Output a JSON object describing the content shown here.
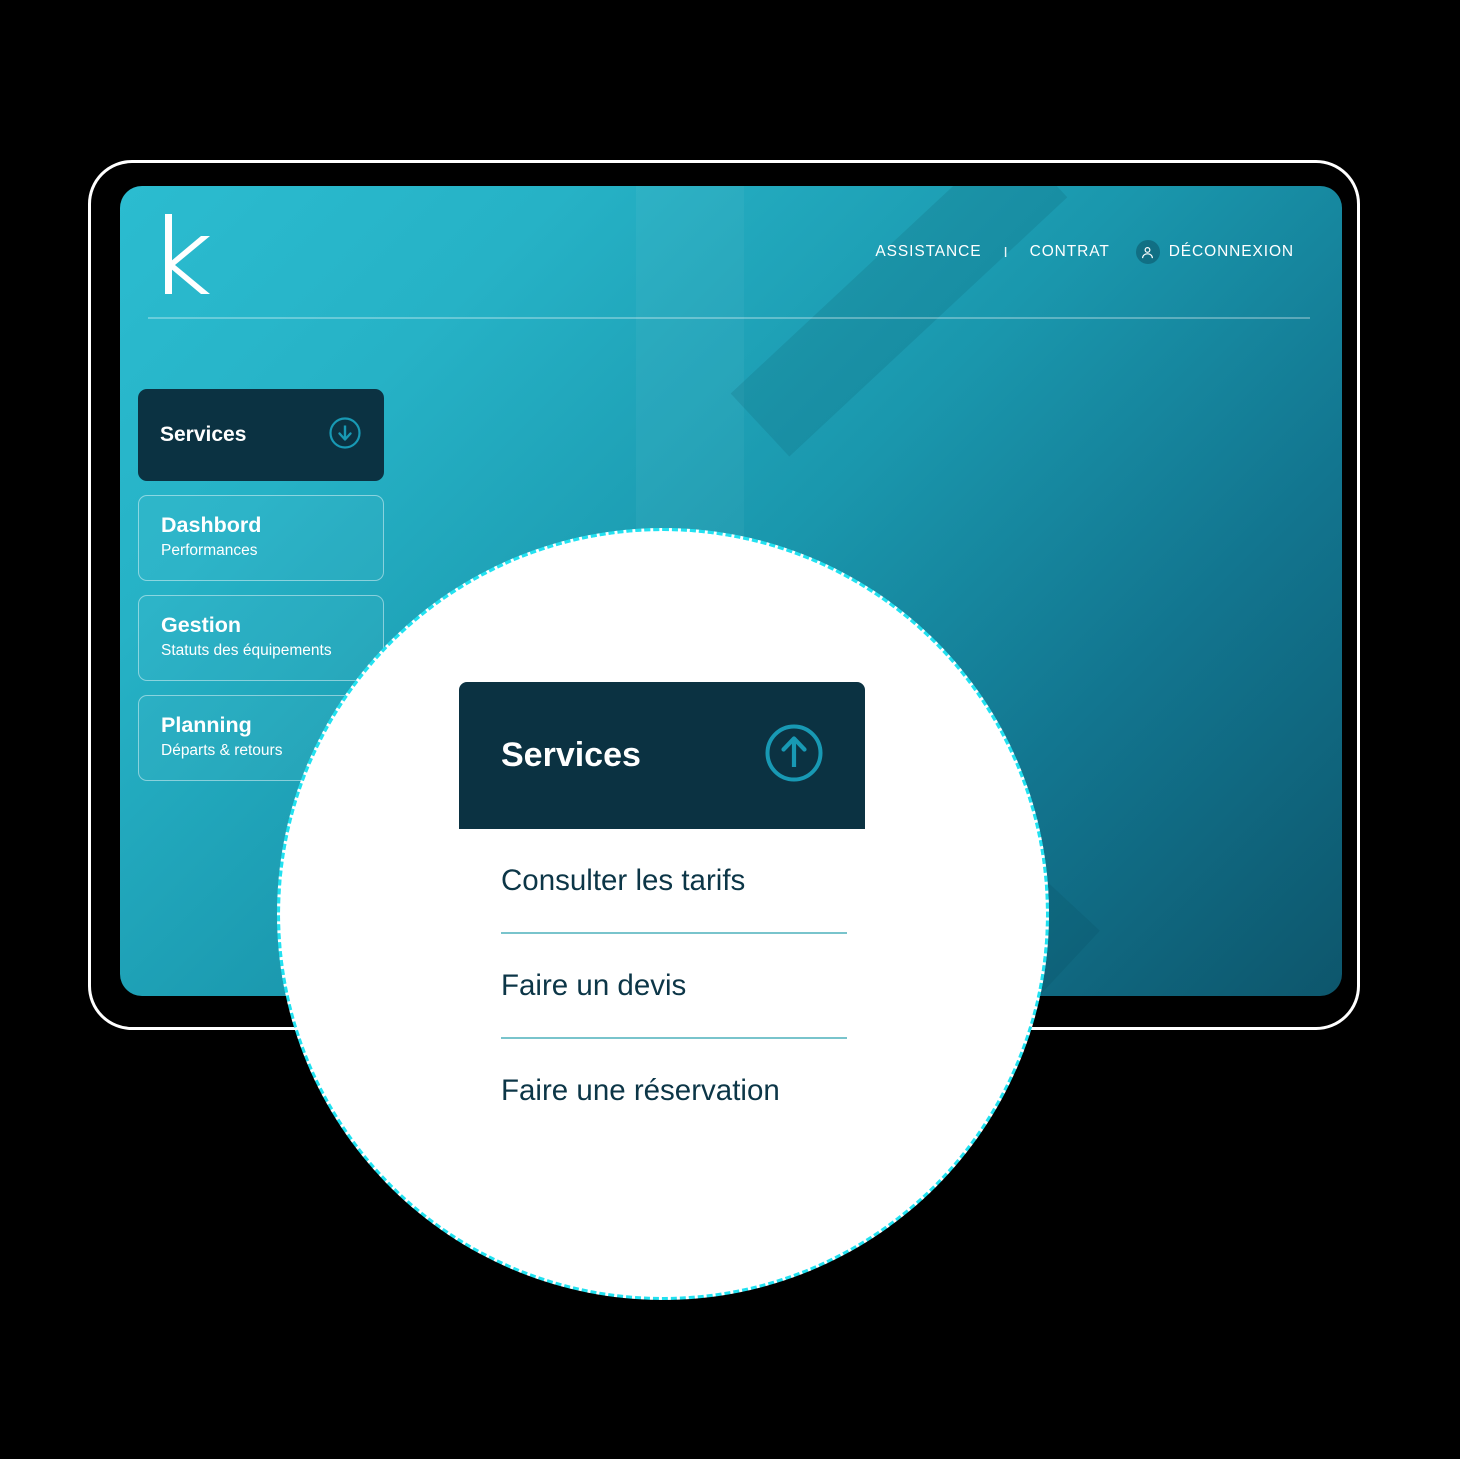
{
  "app": {
    "logo": "k",
    "logo_icon": "letter-k-logo"
  },
  "header": {
    "nav": [
      {
        "label": "ASSISTANCE",
        "icon": ""
      },
      {
        "label": "CONTRAT",
        "icon": ""
      }
    ],
    "separator": "I",
    "account": {
      "label": "DÉCONNEXION",
      "icon": "user-icon"
    }
  },
  "sidebar": {
    "active": {
      "label": "Services",
      "icon": "arrow-down-circle-icon"
    },
    "items": [
      {
        "title": "Dashbord",
        "subtitle": "Performances"
      },
      {
        "title": "Gestion",
        "subtitle": "Statuts des équipements"
      },
      {
        "title": "Planning",
        "subtitle": "Départs & retours"
      }
    ]
  },
  "magnifier": {
    "dropdown": {
      "title": "Services",
      "toggle_icon": "arrow-up-circle-icon",
      "options": [
        "Consulter les tarifs",
        "Faire un devis",
        "Faire une réservation"
      ]
    }
  },
  "colors": {
    "brand_cyan": "#2bbcd0",
    "brand_teal_deep": "#0d566c",
    "panel_dark": "#0b3242",
    "accent_dashed": "#22e1f0",
    "divider": "#79c4cc",
    "text_dark": "#0c3647"
  }
}
